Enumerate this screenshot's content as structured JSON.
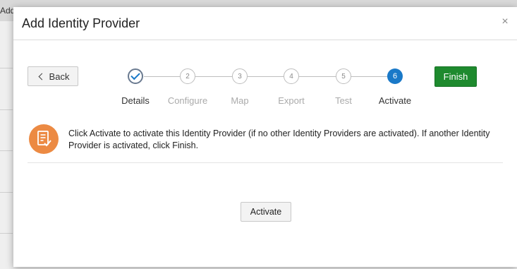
{
  "background": {
    "label": "Add"
  },
  "dialog": {
    "title": "Add Identity Provider",
    "close_glyph": "×",
    "back_label": "Back",
    "finish_label": "Finish",
    "steps": [
      {
        "number": "",
        "label": "Details",
        "state": "visited"
      },
      {
        "number": "2",
        "label": "Configure",
        "state": "upcoming"
      },
      {
        "number": "3",
        "label": "Map",
        "state": "upcoming"
      },
      {
        "number": "4",
        "label": "Export",
        "state": "upcoming"
      },
      {
        "number": "5",
        "label": "Test",
        "state": "upcoming"
      },
      {
        "number": "6",
        "label": "Activate",
        "state": "current"
      }
    ],
    "message": "Click Activate to activate this Identity Provider (if no other Identity Providers are activated). If another Identity Provider is activated, click Finish.",
    "activate_label": "Activate"
  },
  "icons": {
    "close": "close-icon",
    "back": "chevron-left-icon",
    "visited_step": "checkmark-icon",
    "message": "document-checklist-icon"
  },
  "colors": {
    "finish_button": "#1e8a2e",
    "current_step": "#1a79c8",
    "message_icon": "#ec8a43"
  }
}
